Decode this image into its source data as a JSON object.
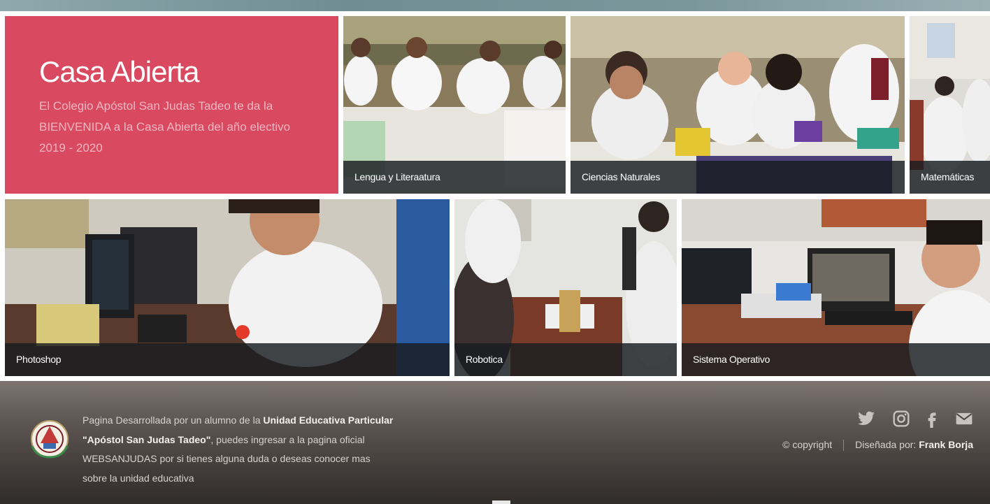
{
  "hero": {
    "title": "Casa Abierta",
    "description": "El Colegio Apóstol San Judas Tadeo te da la BIENVENIDA a la Casa Abierta del año electivo 2019 - 2020"
  },
  "gallery": [
    {
      "caption": "Lengua y Literaatura"
    },
    {
      "caption": "Ciencias Naturales"
    },
    {
      "caption": "Matemáticas"
    },
    {
      "caption": "Photoshop"
    },
    {
      "caption": "Robotica"
    },
    {
      "caption": "Sistema Operativo"
    }
  ],
  "footer": {
    "text_part1": "Pagina Desarrollada por un alumno de la ",
    "school_name": "Unidad Educativa Particular \"Apóstol San Judas Tadeo\"",
    "text_part2": ", puedes ingresar a la pagina oficial ",
    "site_link": "WEBSANJUDAS",
    "text_part3": " por si tienes alguna duda o deseas conocer mas sobre la unidad educativa",
    "copyright": "© copyright",
    "designed_by_label": "Diseñada por: ",
    "designer": "Frank Borja",
    "social_icons": [
      "twitter-icon",
      "instagram-icon",
      "facebook-icon",
      "mail-icon"
    ]
  },
  "colors": {
    "hero_bg": "#d94a61",
    "caption_bg": "#191c20",
    "footer_text": "#d8d2ce",
    "icon": "#c9c3bf"
  }
}
